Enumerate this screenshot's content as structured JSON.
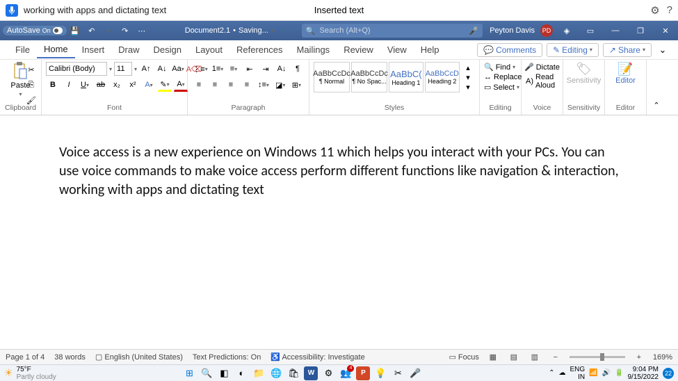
{
  "voice": {
    "command": "working with apps and dictating text",
    "notice": "Inserted text"
  },
  "title": {
    "autosave": "AutoSave",
    "on": "On",
    "docname": "Document2.1",
    "saving": "Saving...",
    "search": "Search (Alt+Q)",
    "user": "Peyton Davis",
    "initials": "PD"
  },
  "tabs": {
    "file": "File",
    "home": "Home",
    "insert": "Insert",
    "draw": "Draw",
    "design": "Design",
    "layout": "Layout",
    "references": "References",
    "mailings": "Mailings",
    "review": "Review",
    "view": "View",
    "help": "Help",
    "comments": "Comments",
    "editing": "Editing",
    "share": "Share"
  },
  "ribbon": {
    "paste": "Paste",
    "clipboard": "Clipboard",
    "font_name": "Calibri (Body)",
    "font_size": "11",
    "font": "Font",
    "paragraph": "Paragraph",
    "styles_sample": "AaBbCcDc",
    "styles_sample_h": "AaBbC(",
    "styles_sample_h2": "AaBbCcD",
    "normal": "¶ Normal",
    "nospac": "¶ No Spac...",
    "h1": "Heading 1",
    "h2": "Heading 2",
    "styles": "Styles",
    "find": "Find",
    "replace": "Replace",
    "select": "Select",
    "editing": "Editing",
    "dictate": "Dictate",
    "readaloud": "Read Aloud",
    "voice": "Voice",
    "sensitivity": "Sensitivity",
    "sensitivity_g": "Sensitivity",
    "editor": "Editor",
    "editor_g": "Editor"
  },
  "document": {
    "text": "Voice access is a new experience on Windows 11 which helps you interact with your PCs. You can use voice commands to make voice access perform different functions like navigation & interaction, working with apps and dictating text"
  },
  "status": {
    "page": "Page 1 of 4",
    "words": "38 words",
    "lang": "English (United States)",
    "pred": "Text Predictions: On",
    "access": "Accessibility: Investigate",
    "focus": "Focus",
    "zoom": "169%"
  },
  "taskbar": {
    "temp": "75°F",
    "weather": "Partly cloudy",
    "lang1": "ENG",
    "lang2": "IN",
    "time": "9:04 PM",
    "date": "9/15/2022",
    "notif": "22"
  }
}
